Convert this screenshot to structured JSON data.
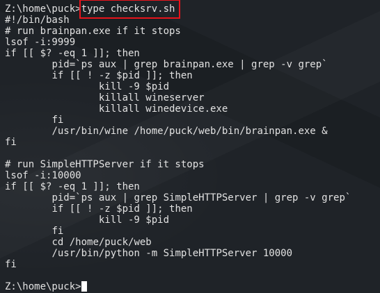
{
  "prompt": "Z:\\home\\puck>",
  "command": "type checksrv.sh",
  "highlight_color": "#e8141c",
  "output_lines": [
    "#!/bin/bash",
    "# run brainpan.exe if it stops",
    "lsof -i:9999",
    "if [[ $? -eq 1 ]]; then",
    "\tpid=`ps aux | grep brainpan.exe | grep -v grep`",
    "\tif [[ ! -z $pid ]]; then",
    "\t\tkill -9 $pid",
    "\t\tkillall wineserver",
    "\t\tkillall winedevice.exe",
    "\tfi",
    "\t/usr/bin/wine /home/puck/web/bin/brainpan.exe &",
    "fi",
    "",
    "# run SimpleHTTPServer if it stops",
    "lsof -i:10000",
    "if [[ $? -eq 1 ]]; then",
    "\tpid=`ps aux | grep SimpleHTTPServer | grep -v grep`",
    "\tif [[ ! -z $pid ]]; then",
    "\t\tkill -9 $pid",
    "\tfi",
    "\tcd /home/puck/web",
    "\t/usr/bin/python -m SimpleHTTPServer 10000",
    "fi",
    ""
  ],
  "final_prompt": "Z:\\home\\puck>"
}
